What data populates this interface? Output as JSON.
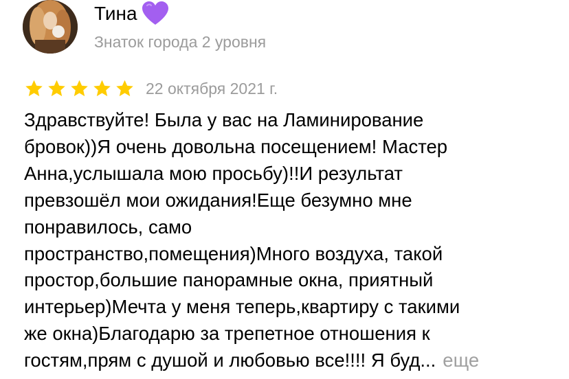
{
  "user": {
    "name": "Тина",
    "badge_icon": "purple-heart-icon",
    "level": "Знаток города 2 уровня"
  },
  "review": {
    "rating": 5,
    "rating_max": 5,
    "star_color": "#ffcc00",
    "date": "22 октября 2021 г.",
    "text": "Здравствуйте! Была у вас на Ламинирование\nбровок))Я очень довольна посещением! Мастер\nАнна,услышала мою просьбу)!!И результат\nпревзошёл мои ожидания!Еще безумно мне\nпонравилось, само\nпространство,помещения)Много воздуха, такой\nпростор,большие панорамные окна, приятный\nинтерьер)Мечта у меня теперь,квартиру с такими\nже окна)Благодарю за трепетное отношения к\nгостям,прям с душой и любовью все!!!! Я буд...",
    "more_label": "еще"
  }
}
